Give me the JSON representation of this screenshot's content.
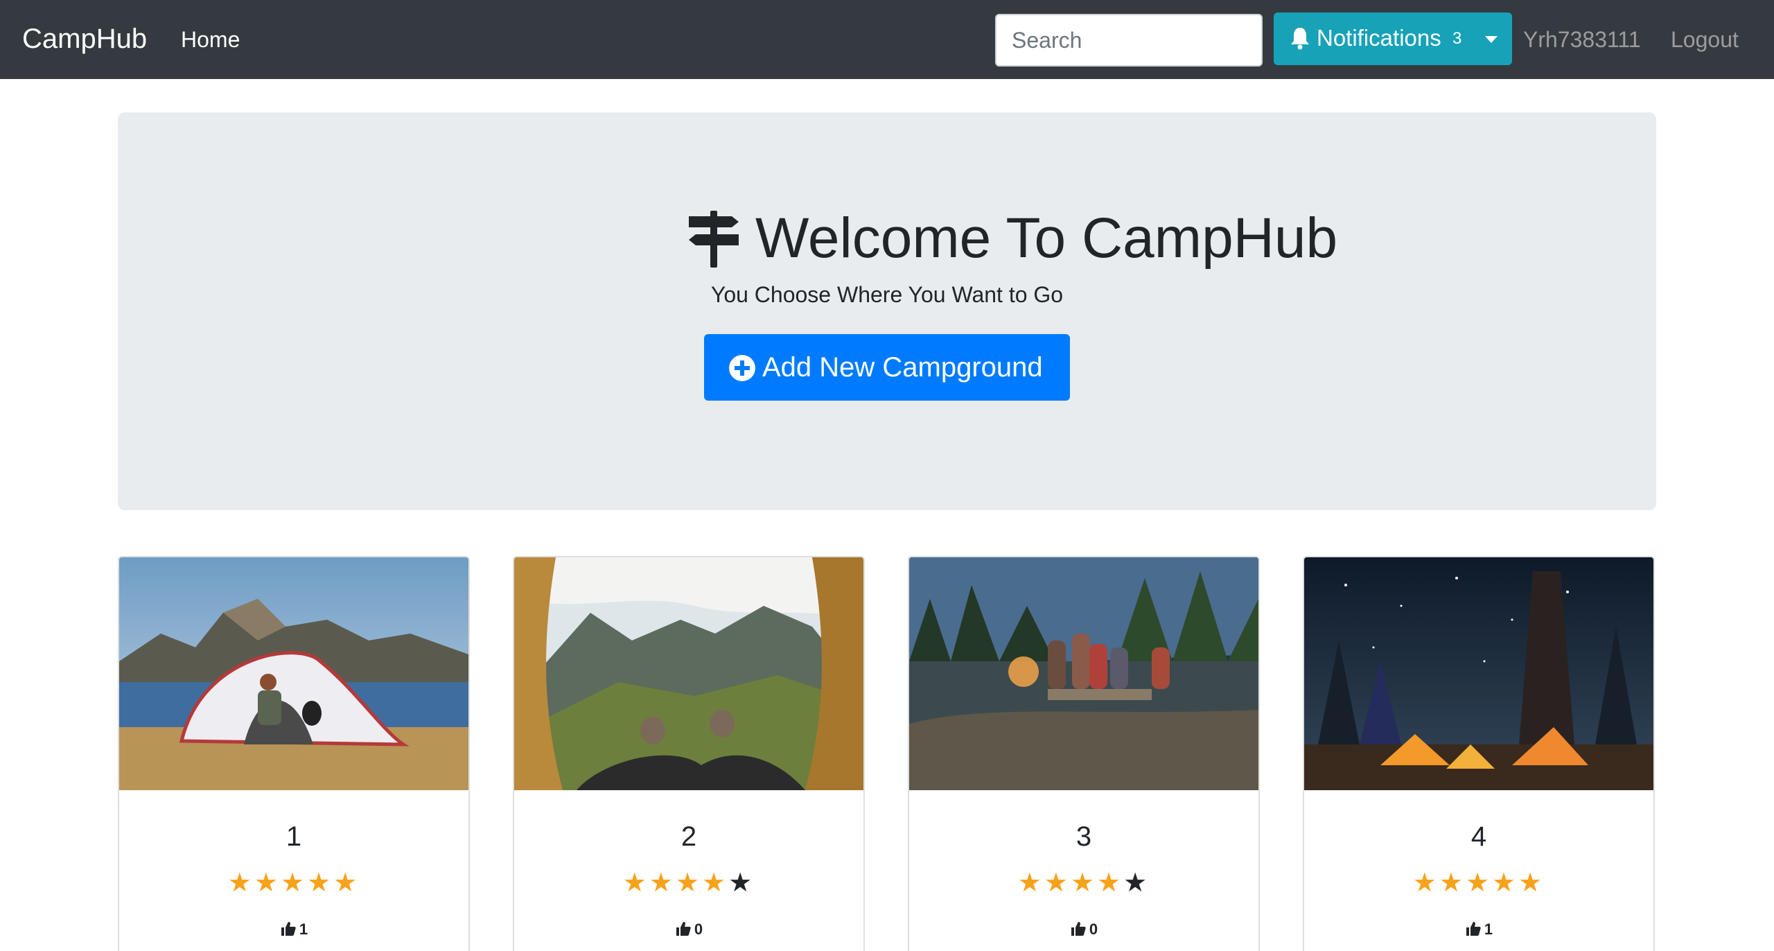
{
  "navbar": {
    "brand": "CampHub",
    "home_label": "Home",
    "search_placeholder": "Search",
    "notifications_label": "Notifications",
    "notifications_count": "3",
    "username": "Yrh7383111",
    "logout_label": "Logout"
  },
  "hero": {
    "title": "Welcome To CampHub",
    "subtitle": "You Choose Where You Want to Go",
    "add_button_label": "Add New Campground"
  },
  "campgrounds": [
    {
      "name": "1",
      "rating": 5,
      "likes": "1",
      "image": "tent-lakeside-mountains"
    },
    {
      "name": "2",
      "rating": 4,
      "likes": "0",
      "image": "tent-view-mountain-valley"
    },
    {
      "name": "3",
      "rating": 4,
      "likes": "0",
      "image": "campfire-group-forest"
    },
    {
      "name": "4",
      "rating": 5,
      "likes": "1",
      "image": "tents-night-starry-sky"
    }
  ],
  "colors": {
    "navbar": "#343a40",
    "notifications": "#17a2b8",
    "primary": "#007bff",
    "jumbotron": "#e9ecef",
    "star_on": "#f7a21b",
    "star_off": "#212529"
  },
  "icons": {
    "notifications": "bell-icon",
    "hero": "signpost-icon",
    "add": "plus-circle-icon",
    "likes": "thumbs-up-icon"
  }
}
